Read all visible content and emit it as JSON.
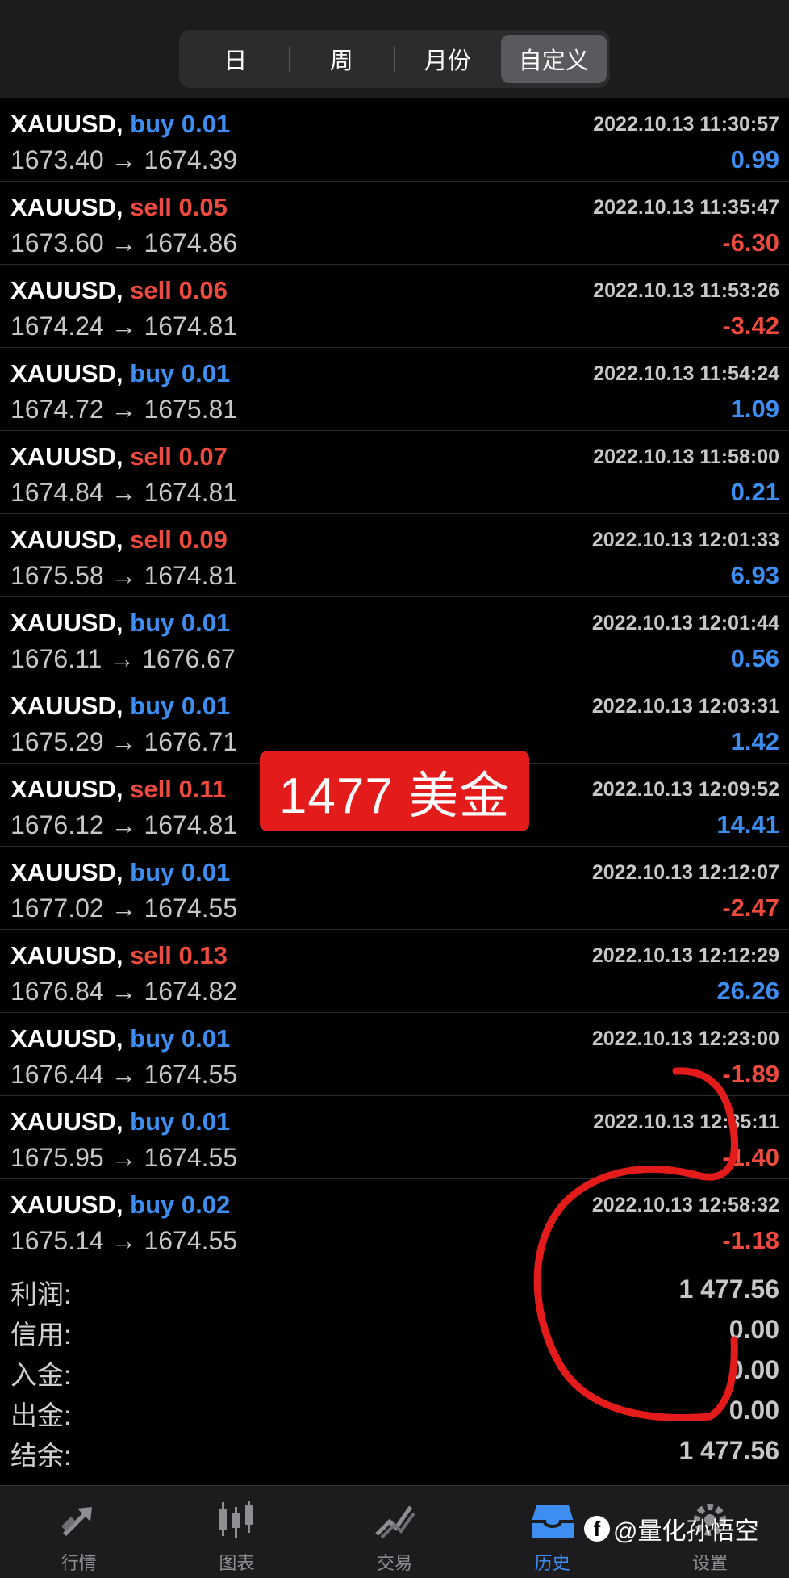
{
  "tabs_top": [
    {
      "label": "日",
      "active": false
    },
    {
      "label": "周",
      "active": false
    },
    {
      "label": "月份",
      "active": false
    },
    {
      "label": "自定义",
      "active": true
    }
  ],
  "deals": [
    {
      "symbol": "XAUUSD,",
      "side": "buy",
      "volume": "0.01",
      "time": "2022.10.13 11:30:57",
      "prices": "1673.40 → 1674.39",
      "profit": "0.99",
      "profit_sign": "pos"
    },
    {
      "symbol": "XAUUSD,",
      "side": "sell",
      "volume": "0.05",
      "time": "2022.10.13 11:35:47",
      "prices": "1673.60 → 1674.86",
      "profit": "-6.30",
      "profit_sign": "neg"
    },
    {
      "symbol": "XAUUSD,",
      "side": "sell",
      "volume": "0.06",
      "time": "2022.10.13 11:53:26",
      "prices": "1674.24 → 1674.81",
      "profit": "-3.42",
      "profit_sign": "neg"
    },
    {
      "symbol": "XAUUSD,",
      "side": "buy",
      "volume": "0.01",
      "time": "2022.10.13 11:54:24",
      "prices": "1674.72 → 1675.81",
      "profit": "1.09",
      "profit_sign": "pos"
    },
    {
      "symbol": "XAUUSD,",
      "side": "sell",
      "volume": "0.07",
      "time": "2022.10.13 11:58:00",
      "prices": "1674.84 → 1674.81",
      "profit": "0.21",
      "profit_sign": "pos"
    },
    {
      "symbol": "XAUUSD,",
      "side": "sell",
      "volume": "0.09",
      "time": "2022.10.13 12:01:33",
      "prices": "1675.58 → 1674.81",
      "profit": "6.93",
      "profit_sign": "pos"
    },
    {
      "symbol": "XAUUSD,",
      "side": "buy",
      "volume": "0.01",
      "time": "2022.10.13 12:01:44",
      "prices": "1676.11 → 1676.67",
      "profit": "0.56",
      "profit_sign": "pos"
    },
    {
      "symbol": "XAUUSD,",
      "side": "buy",
      "volume": "0.01",
      "time": "2022.10.13 12:03:31",
      "prices": "1675.29 → 1676.71",
      "profit": "1.42",
      "profit_sign": "pos"
    },
    {
      "symbol": "XAUUSD,",
      "side": "sell",
      "volume": "0.11",
      "time": "2022.10.13 12:09:52",
      "prices": "1676.12 → 1674.81",
      "profit": "14.41",
      "profit_sign": "pos"
    },
    {
      "symbol": "XAUUSD,",
      "side": "buy",
      "volume": "0.01",
      "time": "2022.10.13 12:12:07",
      "prices": "1677.02 → 1674.55",
      "profit": "-2.47",
      "profit_sign": "neg"
    },
    {
      "symbol": "XAUUSD,",
      "side": "sell",
      "volume": "0.13",
      "time": "2022.10.13 12:12:29",
      "prices": "1676.84 → 1674.82",
      "profit": "26.26",
      "profit_sign": "pos"
    },
    {
      "symbol": "XAUUSD,",
      "side": "buy",
      "volume": "0.01",
      "time": "2022.10.13 12:23:00",
      "prices": "1676.44 → 1674.55",
      "profit": "-1.89",
      "profit_sign": "neg"
    },
    {
      "symbol": "XAUUSD,",
      "side": "buy",
      "volume": "0.01",
      "time": "2022.10.13 12:35:11",
      "prices": "1675.95 → 1674.55",
      "profit": "-1.40",
      "profit_sign": "neg"
    },
    {
      "symbol": "XAUUSD,",
      "side": "buy",
      "volume": "0.02",
      "time": "2022.10.13 12:58:32",
      "prices": "1675.14 → 1674.55",
      "profit": "-1.18",
      "profit_sign": "neg"
    }
  ],
  "summary": [
    {
      "label": "利润:",
      "value": "1 477.56"
    },
    {
      "label": "信用:",
      "value": "0.00"
    },
    {
      "label": "入金:",
      "value": "0.00"
    },
    {
      "label": "出金:",
      "value": "0.00"
    },
    {
      "label": "结余:",
      "value": "1 477.56"
    }
  ],
  "overlay_label": "1477 美金",
  "tabbar": [
    {
      "label": "行情",
      "icon": "quotes-icon",
      "active": false
    },
    {
      "label": "图表",
      "icon": "chart-icon",
      "active": false
    },
    {
      "label": "交易",
      "icon": "trade-icon",
      "active": false
    },
    {
      "label": "历史",
      "icon": "history-icon",
      "active": true
    },
    {
      "label": "设置",
      "icon": "settings-icon",
      "active": false
    }
  ],
  "watermark": {
    "prefix": "f",
    "text": "@量化孙悟空"
  },
  "colors": {
    "buy": "#3d8ef0",
    "sell": "#ee4a3e",
    "highlight": "#e31b1b"
  }
}
